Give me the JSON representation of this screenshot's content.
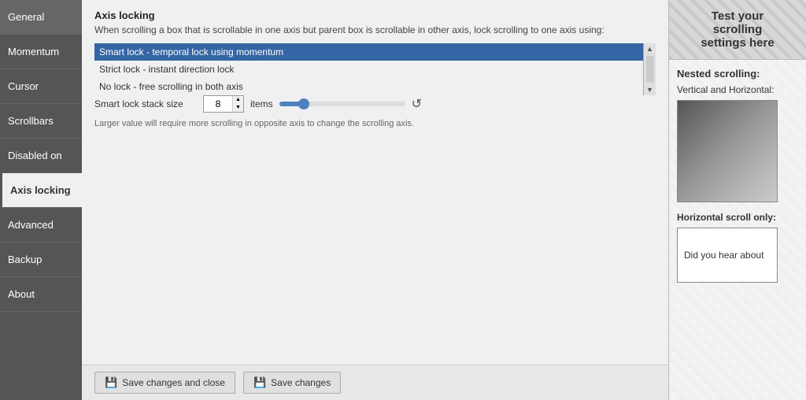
{
  "sidebar": {
    "items": [
      {
        "id": "general",
        "label": "General",
        "active": false
      },
      {
        "id": "momentum",
        "label": "Momentum",
        "active": false
      },
      {
        "id": "cursor",
        "label": "Cursor",
        "active": false
      },
      {
        "id": "scrollbars",
        "label": "Scrollbars",
        "active": false
      },
      {
        "id": "disabled-on",
        "label": "Disabled on",
        "active": false
      },
      {
        "id": "axis-locking",
        "label": "Axis locking",
        "active": true
      },
      {
        "id": "advanced",
        "label": "Advanced",
        "active": false
      },
      {
        "id": "backup",
        "label": "Backup",
        "active": false
      },
      {
        "id": "about",
        "label": "About",
        "active": false
      }
    ]
  },
  "main": {
    "section_title": "Axis locking",
    "section_description": "When scrolling a box that is scrollable in one axis but parent box is scrollable in other axis, lock scrolling to one axis using:",
    "dropdown_options": [
      {
        "value": "smart",
        "label": "Smart lock - temporal lock using momentum",
        "selected": true
      },
      {
        "value": "strict",
        "label": "Strict lock - instant direction lock",
        "selected": false
      },
      {
        "value": "no-lock",
        "label": "No lock - free scrolling in both axis",
        "selected": false
      }
    ],
    "stack_size_label": "Smart lock stack size",
    "stack_size_value": "8",
    "items_label": "items",
    "slider_value": 20,
    "help_text": "Larger value will require more scrolling in opposite axis to change the scrolling axis.",
    "footer": {
      "save_close_label": "Save changes and close",
      "save_label": "Save changes"
    }
  },
  "right_panel": {
    "header": "Test your\nscrolling\nsettings here",
    "nested_title": "Nested scrolling:",
    "nested_subtitle": "Vertical and Horizontal:",
    "horiz_title": "Horizontal scroll only:",
    "horiz_content": "Did you hear about"
  }
}
